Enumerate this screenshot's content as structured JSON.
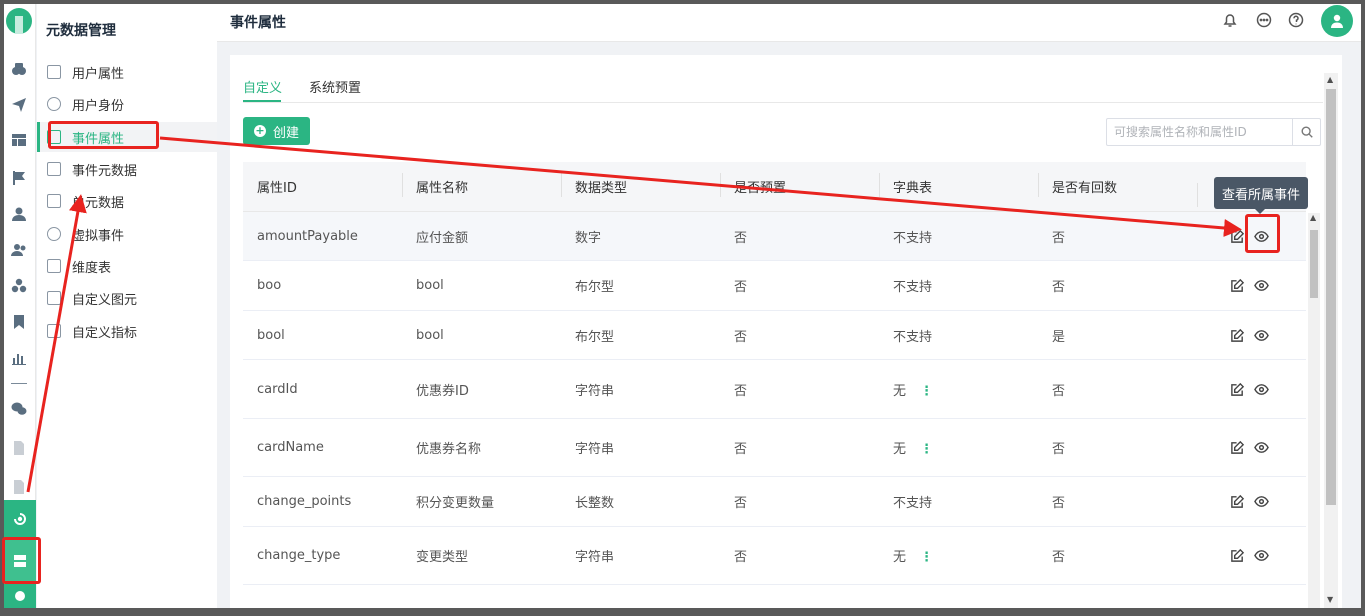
{
  "menu": {
    "title": "元数据管理",
    "items": [
      {
        "label": "用户属性",
        "active": false
      },
      {
        "label": "用户身份",
        "active": false
      },
      {
        "label": "事件属性",
        "active": true
      },
      {
        "label": "事件元数据",
        "active": false
      },
      {
        "label": "单元数据",
        "active": false
      },
      {
        "label": "虚拟事件",
        "active": false
      },
      {
        "label": "维度表",
        "active": false
      },
      {
        "label": "自定义图元",
        "active": false
      },
      {
        "label": "自定义指标",
        "active": false
      }
    ]
  },
  "header": {
    "title": "事件属性",
    "icons": [
      "bell-icon",
      "chat-icon",
      "help-icon",
      "user-avatar"
    ]
  },
  "tabs": [
    {
      "label": "自定义",
      "active": true
    },
    {
      "label": "系统预置",
      "active": false
    }
  ],
  "toolbar": {
    "create_label": "创建",
    "search_placeholder": "可搜索属性名称和属性ID"
  },
  "table": {
    "columns": [
      "属性ID",
      "属性名称",
      "数据类型",
      "是否预置",
      "字典表",
      "是否有回数"
    ],
    "rows": [
      {
        "id": "amountPayable",
        "name": "应付金额",
        "type": "数字",
        "preset": "否",
        "dict": "不支持",
        "dict_more": false,
        "backfill": "否"
      },
      {
        "id": "boo",
        "name": "bool",
        "type": "布尔型",
        "preset": "否",
        "dict": "不支持",
        "dict_more": false,
        "backfill": "否"
      },
      {
        "id": "bool",
        "name": "bool",
        "type": "布尔型",
        "preset": "否",
        "dict": "不支持",
        "dict_more": false,
        "backfill": "是"
      },
      {
        "id": "cardId",
        "name": "优惠券ID",
        "type": "字符串",
        "preset": "否",
        "dict": "无",
        "dict_more": true,
        "backfill": "否"
      },
      {
        "id": "cardName",
        "name": "优惠券名称",
        "type": "字符串",
        "preset": "否",
        "dict": "无",
        "dict_more": true,
        "backfill": "否"
      },
      {
        "id": "change_points",
        "name": "积分变更数量",
        "type": "长整数",
        "preset": "否",
        "dict": "不支持",
        "dict_more": false,
        "backfill": "否"
      },
      {
        "id": "change_type",
        "name": "变更类型",
        "type": "字符串",
        "preset": "否",
        "dict": "无",
        "dict_more": true,
        "backfill": "否"
      }
    ]
  },
  "tooltip": "查看所属事件",
  "dict_more_glyph": "⋮",
  "colors": {
    "accent": "#2bb583",
    "annotation": "#e8231f",
    "tooltip_bg": "#4a5766"
  }
}
